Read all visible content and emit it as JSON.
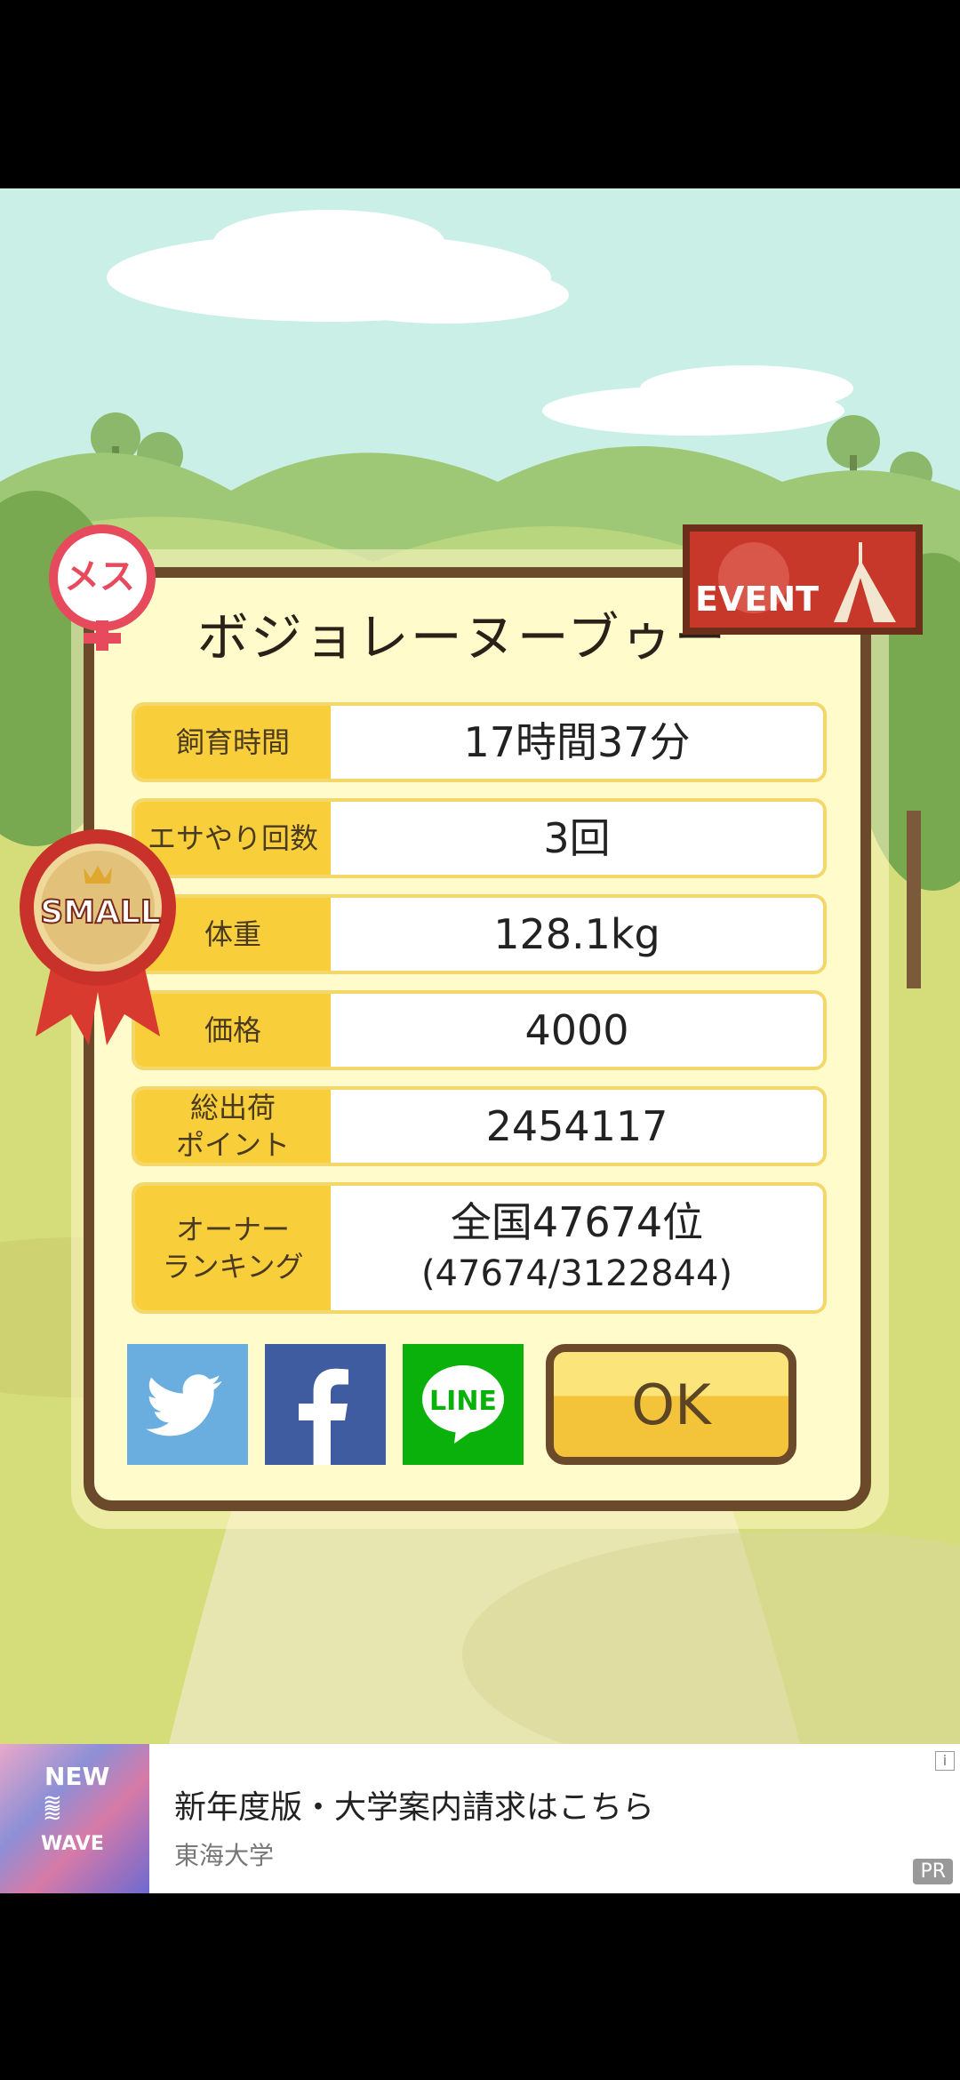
{
  "pet": {
    "name": "ボジョレーヌーブゥー",
    "gender_badge": "メス",
    "event_badge": "EVENT",
    "size_badge": "SMALL"
  },
  "stats": [
    {
      "label": "飼育時間",
      "value": "17時間37分"
    },
    {
      "label": "エサやり回数",
      "value": "3回"
    },
    {
      "label": "体重",
      "value": "128.1kg"
    },
    {
      "label": "価格",
      "value": "4000"
    },
    {
      "label": "総出荷\nポイント",
      "value": "2454117"
    },
    {
      "label": "オーナー\nランキング",
      "value": "全国47674位",
      "value_sub": "(47674/3122844)"
    }
  ],
  "buttons": {
    "twitter": "twitter-icon",
    "facebook": "facebook-icon",
    "line": "LINE",
    "ok": "OK"
  },
  "ad": {
    "image_text_top": "NEW",
    "image_text_bottom": "WAVE",
    "title": "新年度版・大学案内請求はこちら",
    "advertiser": "東海大学",
    "pr_label": "PR",
    "info_label": "i"
  }
}
